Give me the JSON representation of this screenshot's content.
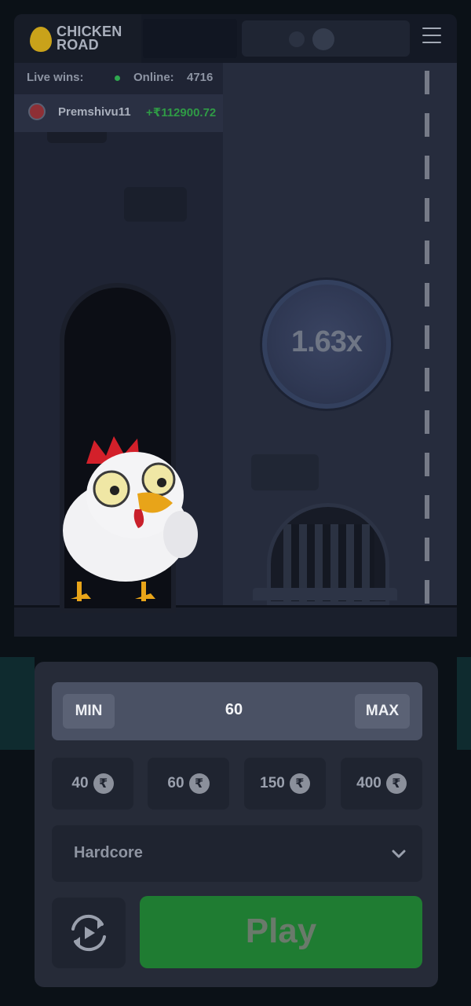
{
  "app": {
    "logo_line1": "CHICKEN",
    "logo_line2": "ROAD"
  },
  "header": {
    "menu_icon": "hamburger-menu-icon"
  },
  "live": {
    "live_wins_label": "Live wins:",
    "online_label": "Online:",
    "online_count": "4716"
  },
  "win_feed": {
    "username": "Premshivu11",
    "amount": "+₹112900.72"
  },
  "game": {
    "multiplier": "1.63x"
  },
  "stake": {
    "min_label": "MIN",
    "value": "60",
    "max_label": "MAX"
  },
  "quick_bets": [
    {
      "amount": "40",
      "currency_symbol": "₹"
    },
    {
      "amount": "60",
      "currency_symbol": "₹"
    },
    {
      "amount": "150",
      "currency_symbol": "₹"
    },
    {
      "amount": "400",
      "currency_symbol": "₹"
    }
  ],
  "difficulty": {
    "selected": "Hardcore",
    "icon": "chevron-down-icon"
  },
  "actions": {
    "auto_icon": "autoplay-refresh-icon",
    "play_label": "Play"
  },
  "colors": {
    "background": "#0b1117",
    "play_button": "#1f7c32",
    "online_dot": "#2fa84f",
    "win_amount": "#2f9a45",
    "logo_egg": "#c9a21a"
  }
}
